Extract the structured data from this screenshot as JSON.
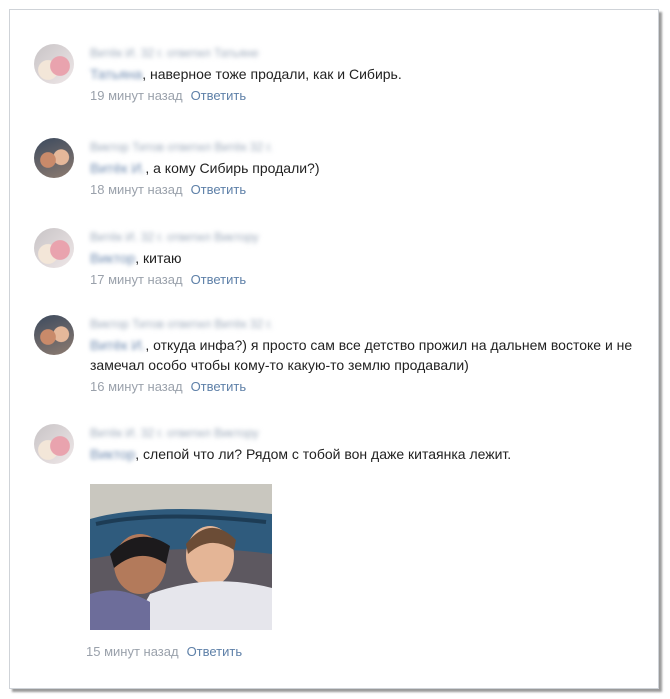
{
  "comments": [
    {
      "author": "Витёк И. 32 г. ответил Татьяне",
      "mention": "Татьяна",
      "text": ", наверное тоже продали, как и Сибирь.",
      "time": "19 минут назад",
      "reply": "Ответить"
    },
    {
      "author": "Виктор Титов ответил Витёк 32 г.",
      "mention": "Витёк И.",
      "text": ", а кому Сибирь продали?)",
      "time": "18 минут назад",
      "reply": "Ответить"
    },
    {
      "author": "Витёк И. 32 г. ответил Виктору",
      "mention": "Виктор",
      "text": ", китаю",
      "time": "17 минут назад",
      "reply": "Ответить"
    },
    {
      "author": "Виктор Титов ответил Витёк 32 г.",
      "mention": "Витёк И.",
      "text": ", откуда инфа?) я просто сам все детство прожил на дальнем востоке и не замечал особо чтобы кому-то какую-то землю продавали)",
      "time": "16 минут назад",
      "reply": "Ответить"
    },
    {
      "author": "Витёк И. 32 г. ответил Виктору",
      "mention": "Виктор",
      "text": ", слепой что ли? Рядом с тобой вон даже китаянка лежит.",
      "time": "15 минут назад",
      "reply": "Ответить"
    }
  ]
}
